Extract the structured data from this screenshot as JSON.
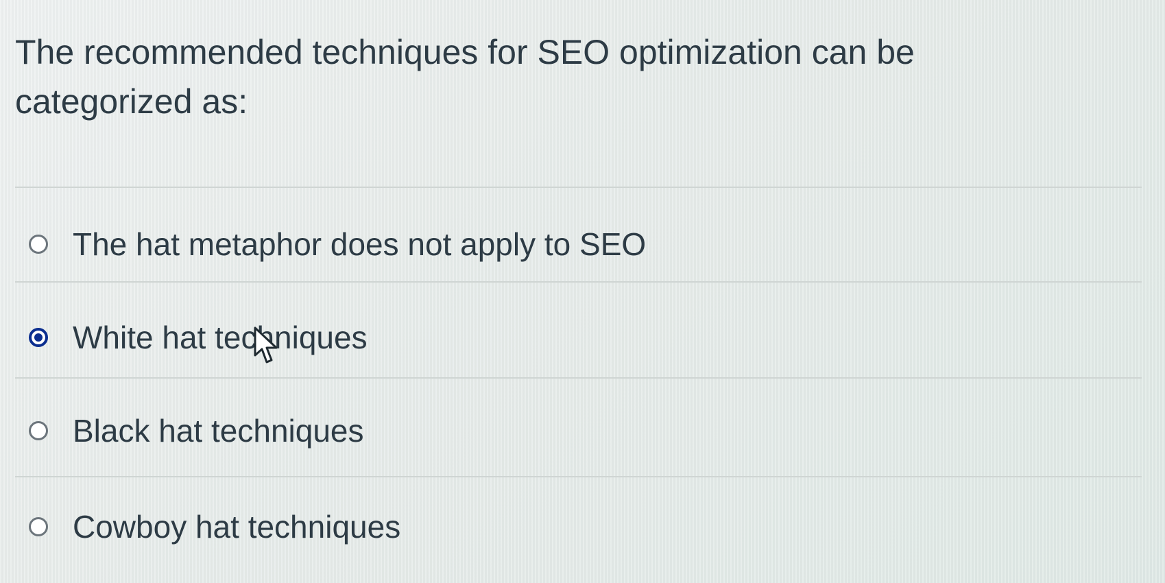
{
  "question": {
    "text": "The recommended techniques for SEO optimization can be categorized as:"
  },
  "answers": [
    {
      "label": "The hat metaphor does not apply to SEO",
      "selected": false
    },
    {
      "label": "White hat techniques",
      "selected": true
    },
    {
      "label": "Black hat techniques",
      "selected": false
    },
    {
      "label": "Cowboy hat techniques",
      "selected": false
    }
  ],
  "colors": {
    "text": "#2d3b45",
    "selected_radio": "#0b2e8f",
    "radio_border": "#6c757c",
    "divider": "#cfd5d3"
  },
  "icons": {
    "cursor": "mouse-pointer-icon"
  }
}
